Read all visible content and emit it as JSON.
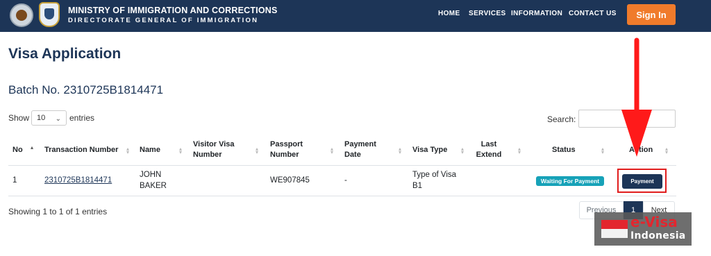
{
  "header": {
    "brand_line1": "MINISTRY OF IMMIGRATION AND CORRECTIONS",
    "brand_line2": "DIRECTORATE GENERAL OF IMMIGRATION",
    "nav": [
      "HOME",
      "SERVICES",
      "INFORMATION",
      "CONTACT US"
    ],
    "signin_label": "Sign In",
    "accent_color": "#f07b2b",
    "bar_color": "#1d3557"
  },
  "main": {
    "title": "Visa Application",
    "batch_label": "Batch No. 2310725B1814471"
  },
  "table_controls": {
    "show_label": "Show",
    "page_size": "10",
    "entries_label": "entries",
    "search_label": "Search:",
    "search_value": ""
  },
  "table": {
    "columns": {
      "no": "No",
      "transaction": "Transaction Number",
      "name": "Name",
      "visitor_visa_l1": "Visitor Visa",
      "visitor_visa_l2": "Number",
      "passport_l1": "Passport",
      "passport_l2": "Number",
      "payment_date_l1": "Payment",
      "payment_date_l2": "Date",
      "visa_type": "Visa Type",
      "last_extend_l1": "Last",
      "last_extend_l2": "Extend",
      "status": "Status",
      "action": "Action"
    },
    "rows": [
      {
        "no": "1",
        "transaction": "2310725B1814471",
        "name_l1": "JOHN",
        "name_l2": "BAKER",
        "visitor_visa": "",
        "passport": "WE907845",
        "payment_date": "-",
        "visa_type_l1": "Type of Visa",
        "visa_type_l2": "B1",
        "last_extend": "",
        "status": "Waiting For Payment",
        "action": "Payment"
      }
    ]
  },
  "footer": {
    "info": "Showing 1 to 1 of 1 entries",
    "prev": "Previous",
    "page": "1",
    "next": "Next"
  },
  "watermark": {
    "line1": "e-Visa",
    "line2": "Indonesia"
  }
}
